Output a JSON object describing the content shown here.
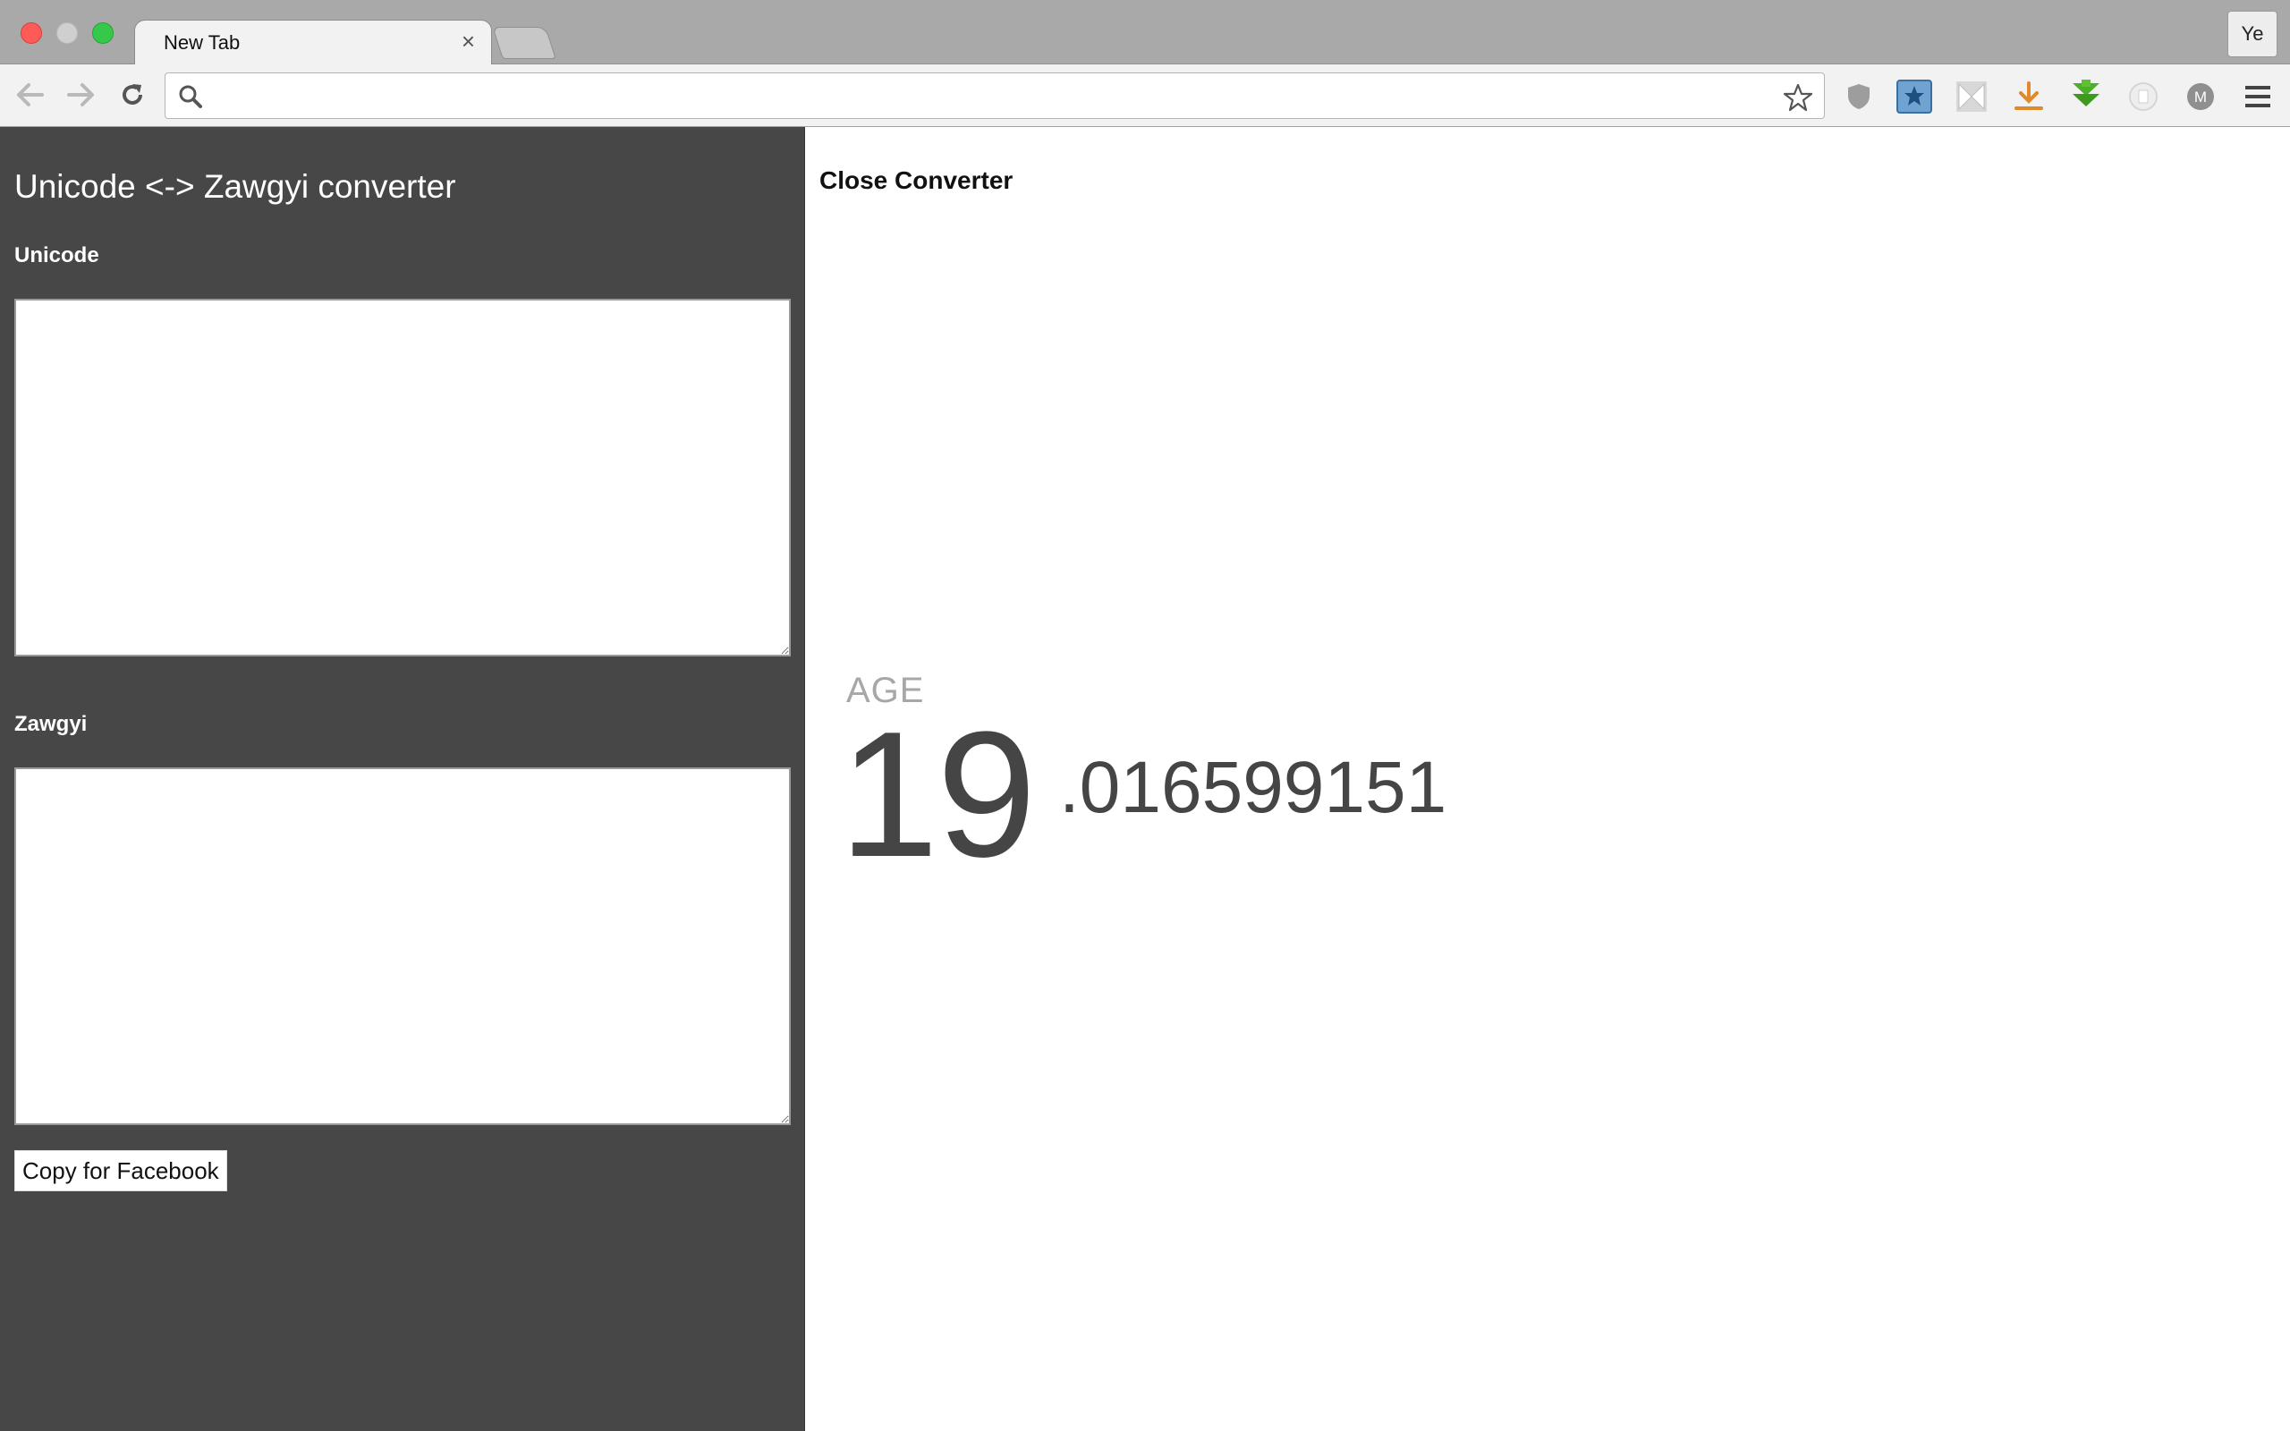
{
  "browser": {
    "tab_title": "New Tab",
    "tab_close": "×",
    "profile_label": "Ye",
    "address_value": "",
    "address_placeholder": ""
  },
  "converter": {
    "title": "Unicode <-> Zawgyi converter",
    "unicode_label": "Unicode",
    "unicode_value": "",
    "zawgyi_label": "Zawgyi",
    "zawgyi_value": "",
    "copy_button": "Copy for Facebook"
  },
  "main": {
    "close_link": "Close Converter",
    "age_label": "AGE",
    "age_integer": "19",
    "age_fraction": ".016599151"
  },
  "extensions": [
    "shield-icon",
    "bookmark-star-icon",
    "bowtie-icon",
    "download-arrow-icon",
    "green-arrows-icon",
    "ghost-icon",
    "m-avatar-icon"
  ],
  "colors": {
    "sidebar_bg": "#474747",
    "age_text": "#454545",
    "age_label": "#a7a7a7"
  }
}
